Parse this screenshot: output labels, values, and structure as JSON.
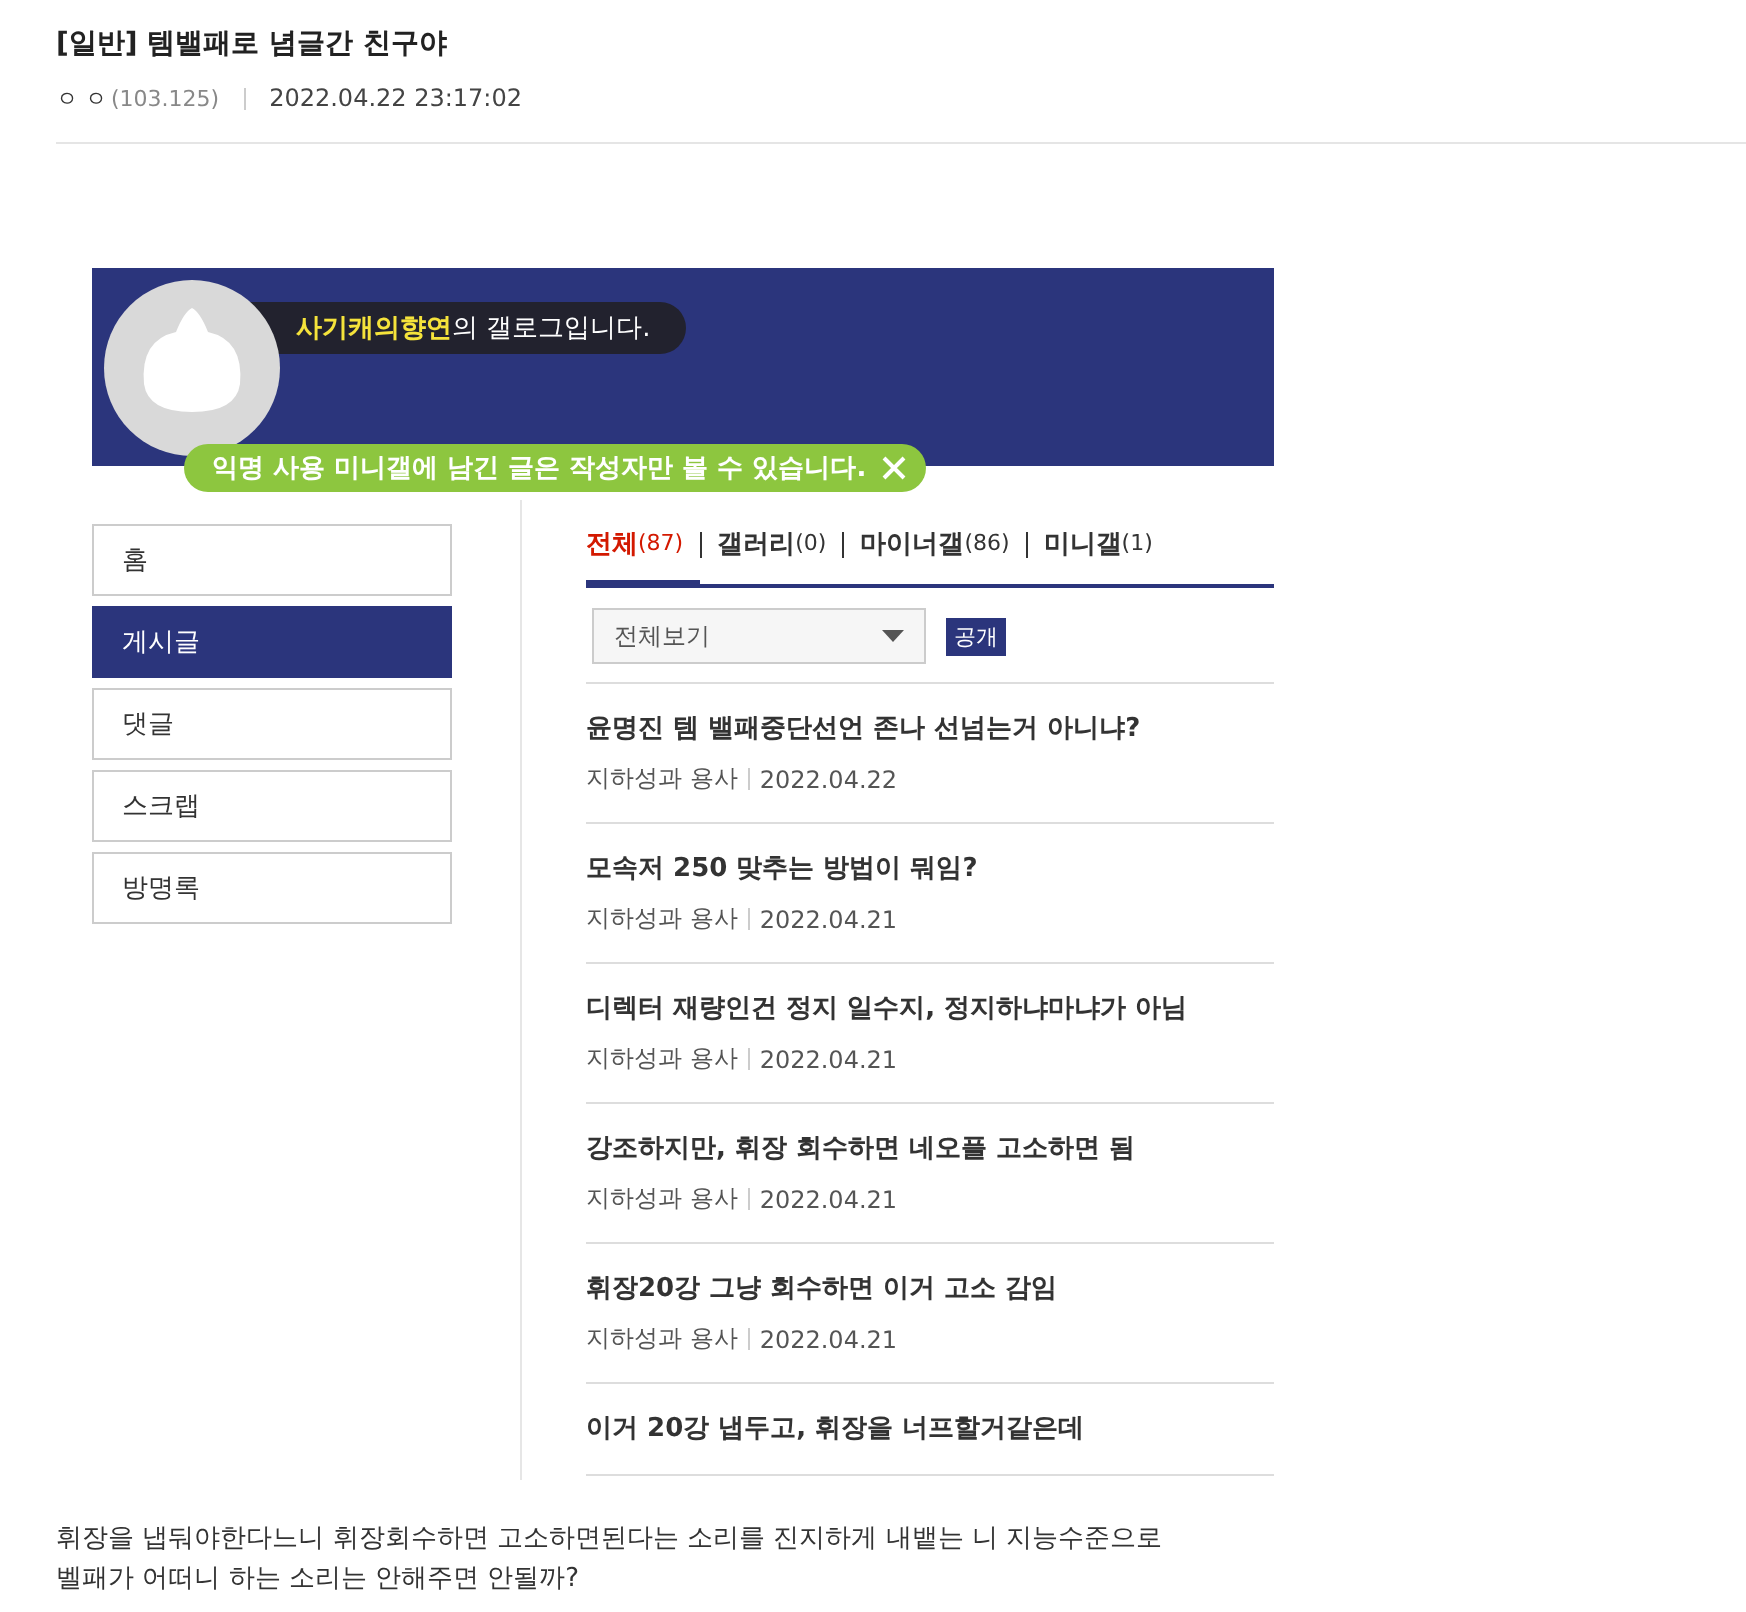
{
  "post": {
    "title": "[일반] 템밸패로 념글간 친구야",
    "author": "ㅇ ㅇ",
    "ip": "(103.125)",
    "date": "2022.04.22 23:17:02"
  },
  "capture": {
    "banner": {
      "greeting": "**사기캐의향연**의 갤로그입니다.",
      "notice": "익명 사용 미니갤에 남긴 글은 작성자만 볼 수 있습니다."
    },
    "menu": [
      {
        "label": "홈",
        "selected": false
      },
      {
        "label": "게시글",
        "selected": true
      },
      {
        "label": "댓글",
        "selected": false
      },
      {
        "label": "스크랩",
        "selected": false
      },
      {
        "label": "방명록",
        "selected": false
      }
    ],
    "tabs": [
      {
        "label": "전체",
        "count": "(87)",
        "selected": true
      },
      {
        "label": "갤러리",
        "count": "(0)",
        "selected": false
      },
      {
        "label": "마이너갤",
        "count": "(86)",
        "selected": false
      },
      {
        "label": "미니갤",
        "count": "(1)",
        "selected": false
      }
    ],
    "filter": {
      "value": "전체보기"
    },
    "visibility": "공개",
    "posts": [
      {
        "title": "윤명진 템 밸패중단선언 존나 선넘는거 아니냐?",
        "gallery": "지하성과 용사",
        "date": "2022.04.22"
      },
      {
        "title": "모속저 250 맞추는 방법이 뭐임?",
        "gallery": "지하성과 용사",
        "date": "2022.04.21"
      },
      {
        "title": "디렉터 재량인건 정지 일수지, 정지하냐마냐가 아님",
        "gallery": "지하성과 용사",
        "date": "2022.04.21"
      },
      {
        "title": "강조하지만, 휘장 회수하면 네오플 고소하면 됨",
        "gallery": "지하성과 용사",
        "date": "2022.04.21"
      },
      {
        "title": "휘장20강 그냥 회수하면 이거 고소 감임",
        "gallery": "지하성과 용사",
        "date": "2022.04.21"
      },
      {
        "title": "이거 20강 냅두고, 휘장을 너프할거같은데"
      }
    ]
  },
  "body": [
    "휘장을 냅둬야한다느니 휘장회수하면 고소하면된다는 소리를 진지하게 내뱉는 니 지능수준으로",
    "벨패가 어떠니 하는 소리는 안해주면 안될까?"
  ]
}
